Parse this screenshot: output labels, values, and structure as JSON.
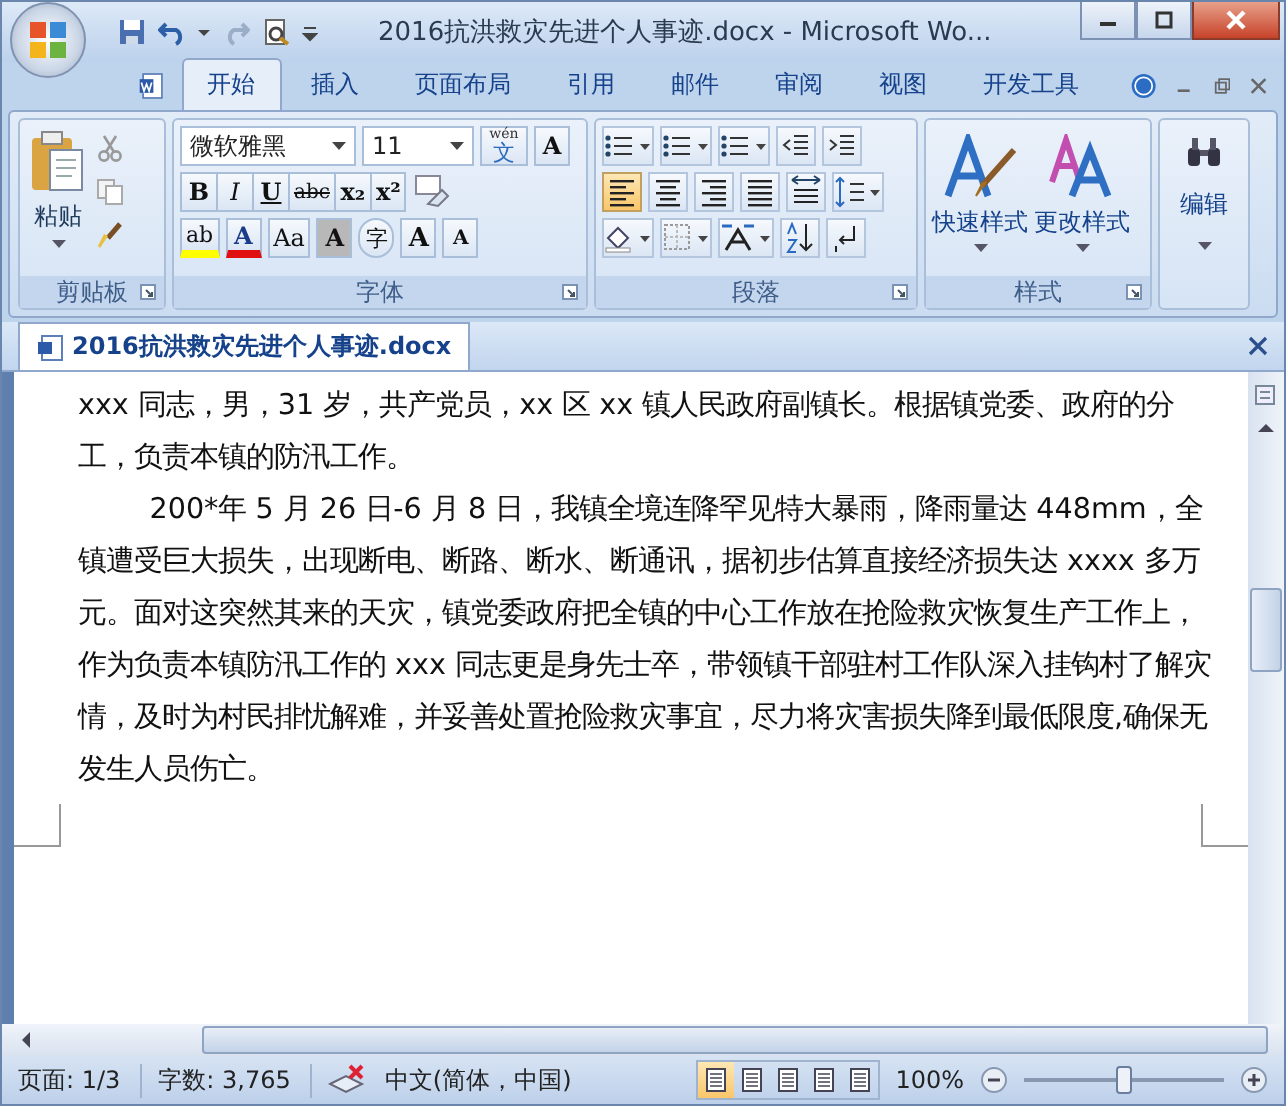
{
  "window": {
    "title": "2016抗洪救灾先进个人事迹.docx - Microsoft Wo..."
  },
  "ribbon_tabs": [
    {
      "label": "开始",
      "selected": true
    },
    {
      "label": "插入",
      "selected": false
    },
    {
      "label": "页面布局",
      "selected": false
    },
    {
      "label": "引用",
      "selected": false
    },
    {
      "label": "邮件",
      "selected": false
    },
    {
      "label": "审阅",
      "selected": false
    },
    {
      "label": "视图",
      "selected": false
    },
    {
      "label": "开发工具",
      "selected": false
    }
  ],
  "clipboard": {
    "paste": "粘贴",
    "label": "剪贴板"
  },
  "font": {
    "name": "微软雅黑",
    "size": "11",
    "phonetic_top": "wén",
    "phonetic_main": "文",
    "char_border": "A",
    "format_buttons": [
      {
        "kind": "bold",
        "label": "B"
      },
      {
        "kind": "italic",
        "label": "I"
      },
      {
        "kind": "underline",
        "label": "U"
      },
      {
        "kind": "strike",
        "label": "abc"
      },
      {
        "kind": "sub",
        "label": "x₂"
      },
      {
        "kind": "sup",
        "label": "x²"
      }
    ],
    "effect_buttons": [
      {
        "kind": "highlight",
        "label": "ab"
      },
      {
        "kind": "font-color",
        "label": "A"
      },
      {
        "kind": "case",
        "label": "Aa"
      },
      {
        "kind": "shading",
        "label": "A"
      },
      {
        "kind": "enclose",
        "label": "字"
      },
      {
        "kind": "grow",
        "label": "A"
      },
      {
        "kind": "shrink",
        "label": "A"
      }
    ],
    "label": "字体"
  },
  "paragraph": {
    "alignment": [
      {
        "selected": true
      },
      {
        "selected": false
      },
      {
        "selected": false
      },
      {
        "selected": false
      }
    ],
    "label": "段落"
  },
  "styles": {
    "quick": "快速样式",
    "change": "更改样式",
    "label": "样式"
  },
  "editing": {
    "label": "编辑"
  },
  "document": {
    "tab": "2016抗洪救灾先进个人事迹.docx",
    "paragraphs": [
      {
        "indent": false,
        "text": "xxx 同志，男，31 岁，共产党员，xx 区 xx 镇人民政府副镇长。根据镇党委、政府的分工，负责本镇的防汛工作。"
      },
      {
        "indent": true,
        "text": "200*年 5 月 26 日-6 月 8 日，我镇全境连降罕见特大暴雨，降雨量达 448mm，全镇遭受巨大损失，出现断电、断路、断水、断通讯，据初步估算直接经济损失达 xxxx 多万元。面对这突然其来的天灾，镇党委政府把全镇的中心工作放在抢险救灾恢复生产工作上，作为负责本镇防汛工作的 xxx 同志更是身先士卒，带领镇干部驻村工作队深入挂钩村了解灾情，及时为村民排忧解难，并妥善处置抢险救灾事宜，尽力将灾害损失降到最低限度,确保无发生人员伤亡。"
      }
    ]
  },
  "status_bar": {
    "page": "页面: 1/3",
    "words": "字数: 3,765",
    "language": "中文(简体，中国)",
    "views": [
      {
        "selected": true
      },
      {
        "selected": false
      },
      {
        "selected": false
      },
      {
        "selected": false
      },
      {
        "selected": false
      }
    ],
    "zoom": "100%",
    "zoom_slider": {
      "level": 0.5
    }
  }
}
